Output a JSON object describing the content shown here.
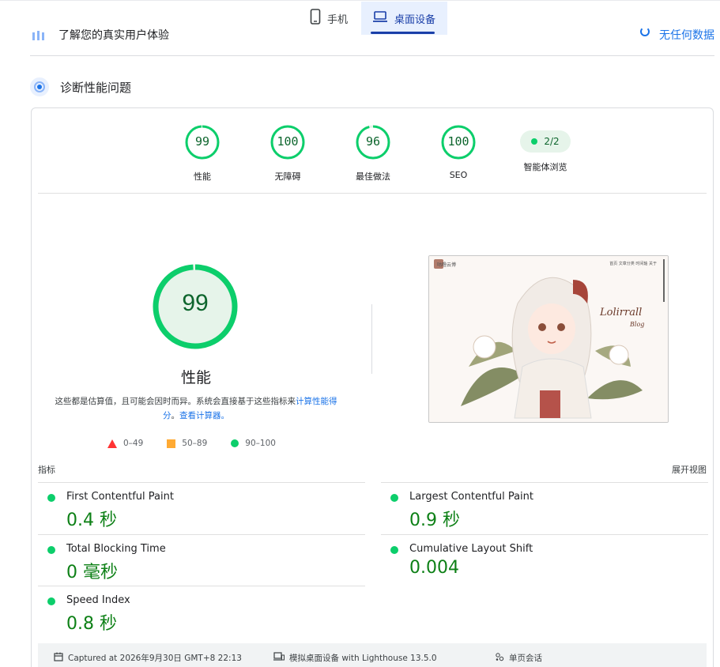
{
  "tabs": {
    "mobile_label": "手机",
    "desktop_label": "桌面设备"
  },
  "prev_row": {
    "text": "了解您的真实用户体验",
    "link": "无任何数据"
  },
  "section": {
    "title": "诊断性能问题"
  },
  "categories": [
    {
      "score": "99",
      "label": "性能",
      "value": 99
    },
    {
      "score": "100",
      "label": "无障碍",
      "value": 100
    },
    {
      "score": "96",
      "label": "最佳做法",
      "value": 96
    },
    {
      "score": "100",
      "label": "SEO",
      "value": 100
    }
  ],
  "agent": {
    "pill": "2/2",
    "label": "智能体浏览"
  },
  "performance": {
    "score": "99",
    "title": "性能",
    "desc_prefix": "这些都是估算值，且可能会因时而异。系统会直接基于这些指标来",
    "desc_link1": "计算性能得分",
    "desc_sep": "。",
    "desc_link2": "查看计算器。"
  },
  "legend": {
    "poor": "0–49",
    "average": "50–89",
    "good": "90–100"
  },
  "thumbnail": {
    "site_name": "咕噜云博",
    "nav": "首页  文章分类  时间轴  关于",
    "signature": "Lolirrall",
    "signature_sub": "Blog"
  },
  "metrics": {
    "header": "指标",
    "toggle": "展开视图",
    "items": [
      {
        "name": "First Contentful Paint",
        "value": "0.4 秒"
      },
      {
        "name": "Largest Contentful Paint",
        "value": "0.9 秒"
      },
      {
        "name": "Total Blocking Time",
        "value": "0 毫秒"
      },
      {
        "name": "Cumulative Layout Shift",
        "value": "0.004"
      },
      {
        "name": "Speed Index",
        "value": "0.8 秒"
      }
    ]
  },
  "footer": {
    "captured": "Captured at 2026年9月30日 GMT+8 22:13",
    "device": "模拟桌面设备 with Lighthouse 13.5.0",
    "session": "单页会话"
  },
  "colors": {
    "good": "#0cce6b",
    "good_text": "#0d652d",
    "accent": "#1a73e8",
    "tab_active": "#1a3fa8"
  },
  "icons": [
    "phone-icon",
    "laptop-icon",
    "people-icon",
    "gauge-icon",
    "calendar-icon",
    "desktop-device-icon",
    "session-icon"
  ]
}
